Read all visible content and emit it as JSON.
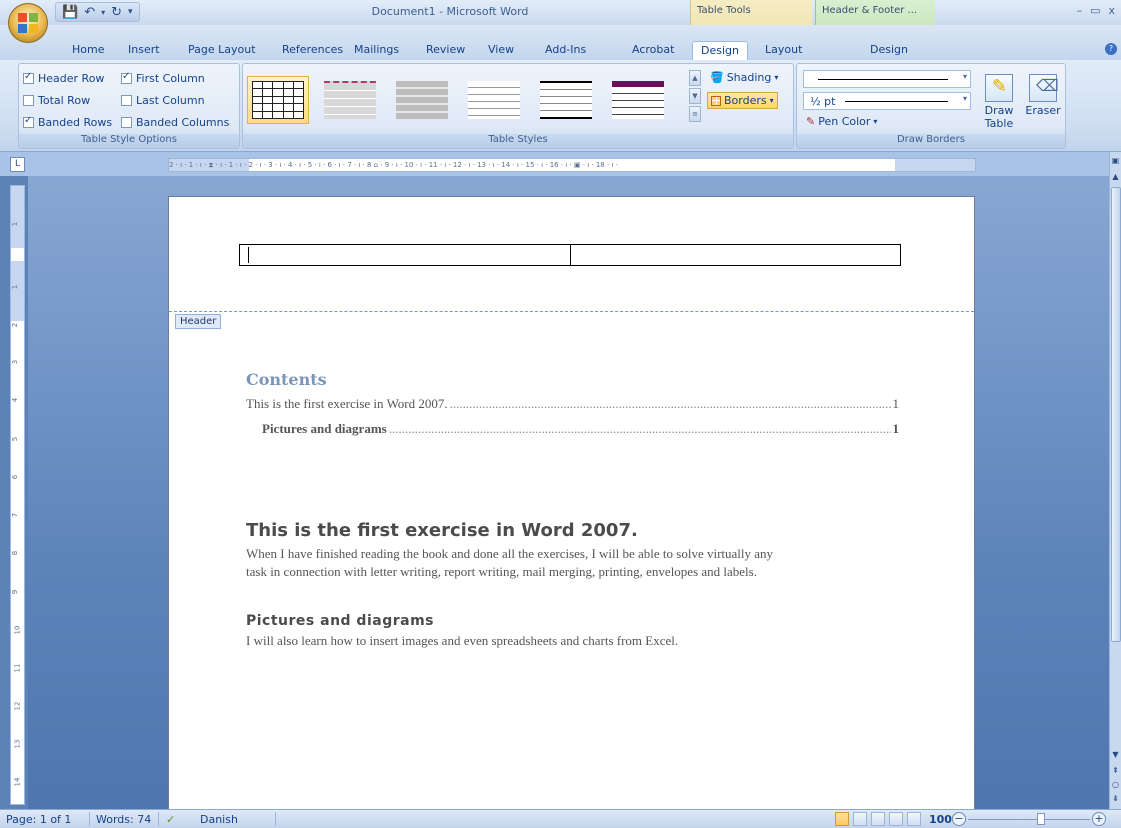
{
  "window": {
    "title": "Document1 - Microsoft Word",
    "contextual_tabs": {
      "table_tools": "Table Tools",
      "header_footer": "Header & Footer ..."
    }
  },
  "tabs": [
    "Home",
    "Insert",
    "Page Layout",
    "References",
    "Mailings",
    "Review",
    "View",
    "Add-Ins",
    "Acrobat",
    "Design",
    "Layout",
    "Design"
  ],
  "ribbon": {
    "table_style_options": {
      "label": "Table Style Options",
      "options": [
        {
          "label": "Header Row",
          "checked": true
        },
        {
          "label": "First Column",
          "checked": true
        },
        {
          "label": "Total Row",
          "checked": false
        },
        {
          "label": "Last Column",
          "checked": false
        },
        {
          "label": "Banded Rows",
          "checked": true
        },
        {
          "label": "Banded Columns",
          "checked": false
        }
      ]
    },
    "table_styles": {
      "label": "Table Styles",
      "shading": "Shading",
      "borders": "Borders"
    },
    "draw_borders": {
      "label": "Draw Borders",
      "pen_weight": "½ pt",
      "pen_color": "Pen Color",
      "draw_table": "Draw Table",
      "eraser": "Eraser"
    }
  },
  "ruler": {
    "horizontal": "2 · ı · 1 · ı · ⧗ · ı · 1 · ı · 2 · ı · 3 · ı · 4 · ı · 5 · ı · 6 · ı · 7 · ı · 8 ⌂ · 9 · ı · 10 · ı · 11 · ı · 12 · ı · 13 · ı · 14 · ı · 15 · ı · 16 · ı · ▣ · ı · 18 · ı ·",
    "vertical_numbers": [
      "1",
      "1",
      "2",
      "3",
      "4",
      "5",
      "6",
      "7",
      "8",
      "9",
      "10",
      "11",
      "12",
      "13",
      "14"
    ]
  },
  "document": {
    "header_tag": "Header",
    "toc_title": "Contents",
    "toc": [
      {
        "text": "This is the first exercise in Word 2007.",
        "page": "1"
      },
      {
        "text": "Pictures and diagrams",
        "page": "1"
      }
    ],
    "heading1": "This is the first exercise in Word 2007.",
    "paragraph1_line1": "When I have finished reading the book and done all the exercises, I will be able to solve virtually any",
    "paragraph1_line2": "task in connection with letter writing, report writing, mail merging, printing, envelopes and labels.",
    "heading2": "Pictures and diagrams",
    "paragraph2": "I will also learn how to insert images and even spreadsheets and charts from Excel."
  },
  "status": {
    "page": "Page: 1 of 1",
    "words": "Words: 74",
    "language": "Danish",
    "zoom": "100%"
  }
}
